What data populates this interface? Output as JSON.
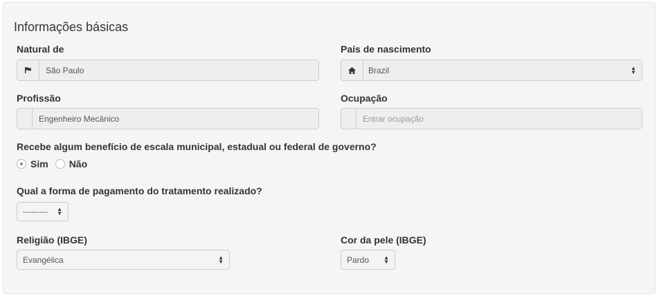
{
  "section": {
    "title": "Informações básicas"
  },
  "natural_de": {
    "label": "Natural de",
    "value": "São Paulo",
    "icon": "flag-icon"
  },
  "pais_nascimento": {
    "label": "País de nascimento",
    "value": "Brazil",
    "icon": "home-icon"
  },
  "profissao": {
    "label": "Profissão",
    "value": "Engenheiro Mecânico"
  },
  "ocupacao": {
    "label": "Ocupação",
    "placeholder": "Entrar ocupação"
  },
  "beneficio": {
    "question": "Recebe algum benefício de escala municipal, estadual ou federal de governo?",
    "options": [
      "Sim",
      "Não"
    ],
    "selected": "Sim"
  },
  "pagamento": {
    "question": "Qual a forma de pagamento do tratamento realizado?",
    "value": "---------"
  },
  "religiao": {
    "label": "Religião (IBGE)",
    "value": "Evangélica"
  },
  "cor_pele": {
    "label": "Cor da pele (IBGE)",
    "value": "Pardo"
  }
}
